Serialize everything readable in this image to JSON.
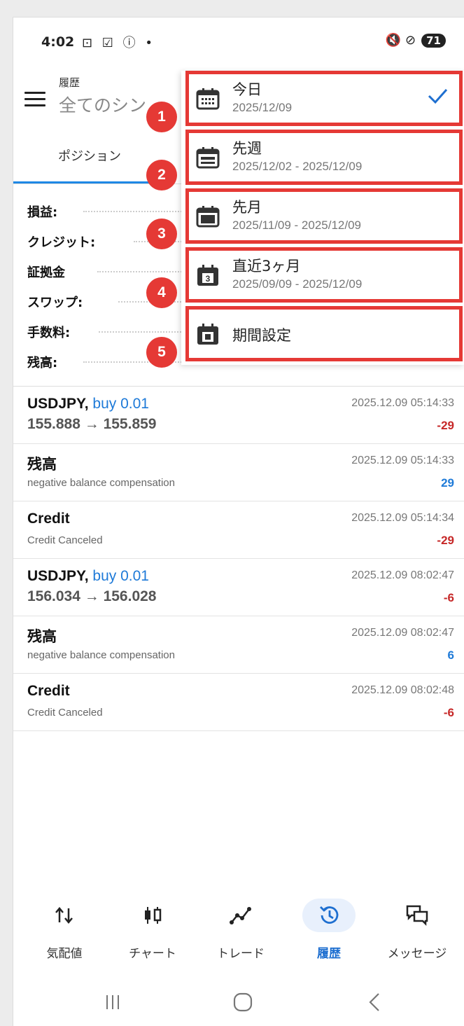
{
  "status_bar": {
    "time": "4:02",
    "left_icons": "⊡ ☑ ⓘ •",
    "right_icons": "🔇 ⊘",
    "battery": "71"
  },
  "header": {
    "subtitle": "履歴",
    "title": "全てのシン"
  },
  "tabs": {
    "positions": "ポジション"
  },
  "summary": [
    {
      "label": "損益:"
    },
    {
      "label": "クレジット:"
    },
    {
      "label": "証拠金"
    },
    {
      "label": "スワップ:"
    },
    {
      "label": "手数料:"
    },
    {
      "label": "残高:"
    }
  ],
  "period_menu": {
    "items": [
      {
        "badge": "1",
        "label": "今日",
        "range": "2025/12/09",
        "selected": true,
        "icon": "calendar-day-icon"
      },
      {
        "badge": "2",
        "label": "先週",
        "range": "2025/12/02 - 2025/12/09",
        "icon": "calendar-week-icon"
      },
      {
        "badge": "3",
        "label": "先月",
        "range": "2025/11/09 - 2025/12/09",
        "icon": "calendar-month-icon"
      },
      {
        "badge": "4",
        "label": "直近3ヶ月",
        "range": "2025/09/09 - 2025/12/09",
        "icon": "calendar-3-icon"
      },
      {
        "badge": "5",
        "label": "期間設定",
        "range": "",
        "icon": "calendar-custom-icon"
      }
    ],
    "accent": "#e53935"
  },
  "transactions": [
    {
      "title": "USDJPY,",
      "side": "buy 0.01",
      "sub": "155.888 → 155.859",
      "time": "2025.12.09 05:14:33",
      "amount": "-29",
      "kind": "trade"
    },
    {
      "title": "残高",
      "side": "",
      "sub": "negative balance compensation",
      "time": "2025.12.09 05:14:33",
      "amount": "29",
      "kind": "balance"
    },
    {
      "title": "Credit",
      "side": "",
      "sub": "Credit Canceled",
      "time": "2025.12.09 05:14:34",
      "amount": "-29",
      "kind": "credit"
    },
    {
      "title": "USDJPY,",
      "side": "buy 0.01",
      "sub": "156.034 → 156.028",
      "time": "2025.12.09 08:02:47",
      "amount": "-6",
      "kind": "trade"
    },
    {
      "title": "残高",
      "side": "",
      "sub": "negative balance compensation",
      "time": "2025.12.09 08:02:47",
      "amount": "6",
      "kind": "balance"
    },
    {
      "title": "Credit",
      "side": "",
      "sub": "Credit Canceled",
      "time": "2025.12.09 08:02:48",
      "amount": "-6",
      "kind": "credit"
    }
  ],
  "bottom_nav": [
    {
      "label": "気配値",
      "icon": "quotes-icon"
    },
    {
      "label": "チャート",
      "icon": "chart-icon"
    },
    {
      "label": "トレード",
      "icon": "trade-icon"
    },
    {
      "label": "履歴",
      "icon": "history-icon",
      "active": true
    },
    {
      "label": "メッセージ",
      "icon": "messages-icon"
    }
  ],
  "colors": {
    "accent_blue": "#1e6fd0",
    "negative": "#c62828",
    "positive": "#1e7ad8",
    "highlight": "#e53935"
  }
}
